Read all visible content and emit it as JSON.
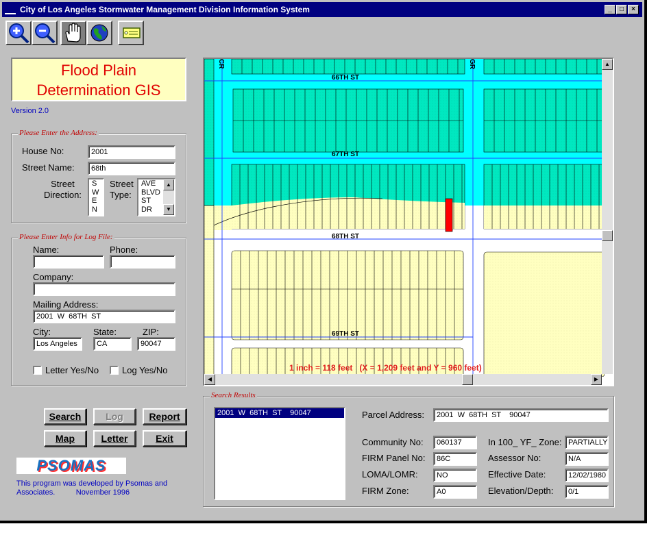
{
  "window": {
    "title": "City of Los Angeles Stormwater Management Division Information System"
  },
  "toolbar": {
    "tools": [
      "zoom-in-icon",
      "zoom-out-icon",
      "pan-hand-icon",
      "globe-icon",
      "label-tag-icon"
    ]
  },
  "app": {
    "title_line1": "Flood Plain",
    "title_line2": "Determination GIS",
    "version": "Version 2.0"
  },
  "address": {
    "legend": "Please Enter the Address:",
    "house_label": "House No:",
    "house_value": "2001",
    "street_label": "Street Name:",
    "street_value": "68th",
    "direction_label1": "Street",
    "direction_label2": "Direction:",
    "directions": [
      "S",
      "W",
      "E",
      "N"
    ],
    "type_label1": "Street",
    "type_label2": "Type:",
    "types": [
      "AVE",
      "BLVD",
      "ST",
      "DR"
    ]
  },
  "log": {
    "legend": "Please Enter Info for Log File:",
    "name_label": "Name:",
    "name_value": "",
    "phone_label": "Phone:",
    "phone_value": "",
    "company_label": "Company:",
    "company_value": "",
    "mailing_label": "Mailing Address:",
    "mailing_value": "2001  W  68TH  ST",
    "city_label": "City:",
    "city_value": "Los Angeles",
    "state_label": "State:",
    "state_value": "CA",
    "zip_label": "ZIP:",
    "zip_value": "90047",
    "letter_label": "Letter Yes/No",
    "log_label": "Log Yes/No"
  },
  "buttons": {
    "search": "Search",
    "log": "Log",
    "report": "Report",
    "map": "Map",
    "letter": "Letter",
    "exit": "Exit"
  },
  "credits": {
    "logo": "PSOMAS",
    "line1": "This program was developed by Psomas and",
    "line2": "Associates.          November 1996"
  },
  "map": {
    "streets": [
      "66TH ST",
      "67TH ST",
      "68TH ST",
      "69TH ST"
    ],
    "cross_street_left": "CR",
    "cross_street_right": "GR",
    "scale_text": "1 inch = 118 feet   (X = 1,209 feet and Y = 960 feet)",
    "colors": {
      "flood": "#00ffff",
      "parcel_flood": "#00e8c0",
      "parcel_dry": "#ffffc0",
      "selected": "#ff0000"
    }
  },
  "results": {
    "legend": "Search Results",
    "items": [
      "2001  W  68TH  ST    90047"
    ],
    "parcel_label": "Parcel Address:",
    "parcel_value": "2001  W  68TH  ST    90047",
    "community_label": "Community No:",
    "community_value": "060137",
    "firm_panel_label": "FIRM Panel No:",
    "firm_panel_value": "86C",
    "loma_label": "LOMA/LOMR:",
    "loma_value": "NO",
    "firm_zone_label": "FIRM Zone:",
    "firm_zone_value": "A0",
    "in100_label": "In 100_ YF_ Zone:",
    "in100_value": "PARTIALLY",
    "assessor_label": "Assessor No:",
    "assessor_value": "N/A",
    "effective_label": "Effective Date:",
    "effective_value": "12/02/1980",
    "elevation_label": "Elevation/Depth:",
    "elevation_value": "0/1"
  }
}
